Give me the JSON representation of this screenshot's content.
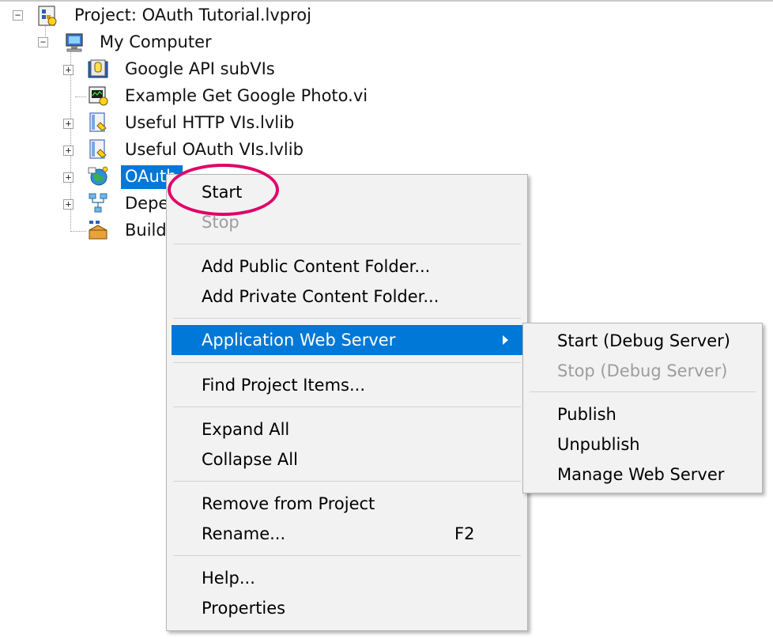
{
  "tree": {
    "project_label": "Project: OAuth Tutorial.lvproj",
    "computer_label": "My Computer",
    "items": [
      {
        "label": "Google API subVIs",
        "icon": "folder-vi-icon"
      },
      {
        "label": "Example Get Google Photo.vi",
        "icon": "vi-icon"
      },
      {
        "label": "Useful HTTP VIs.lvlib",
        "icon": "library-icon"
      },
      {
        "label": "Useful OAuth VIs.lvlib",
        "icon": "library-icon"
      },
      {
        "label": "OAuth",
        "icon": "web-service-icon"
      },
      {
        "label": "Dependencies",
        "icon": "dependencies-icon"
      },
      {
        "label": "Build Specifications",
        "icon": "build-specifications-icon"
      }
    ]
  },
  "context_menu": {
    "start": "Start",
    "stop": "Stop",
    "add_public": "Add Public Content Folder...",
    "add_private": "Add Private Content Folder...",
    "app_web_server": "Application Web Server",
    "find_items": "Find Project Items...",
    "expand_all": "Expand All",
    "collapse_all": "Collapse All",
    "remove": "Remove from Project",
    "rename": "Rename...",
    "rename_shortcut": "F2",
    "help": "Help...",
    "properties": "Properties"
  },
  "submenu": {
    "start_debug": "Start (Debug Server)",
    "stop_debug": "Stop (Debug Server)",
    "publish": "Publish",
    "unpublish": "Unpublish",
    "manage": "Manage Web Server"
  },
  "colors": {
    "highlight": "#0078d7",
    "annotation": "#e0006a"
  }
}
